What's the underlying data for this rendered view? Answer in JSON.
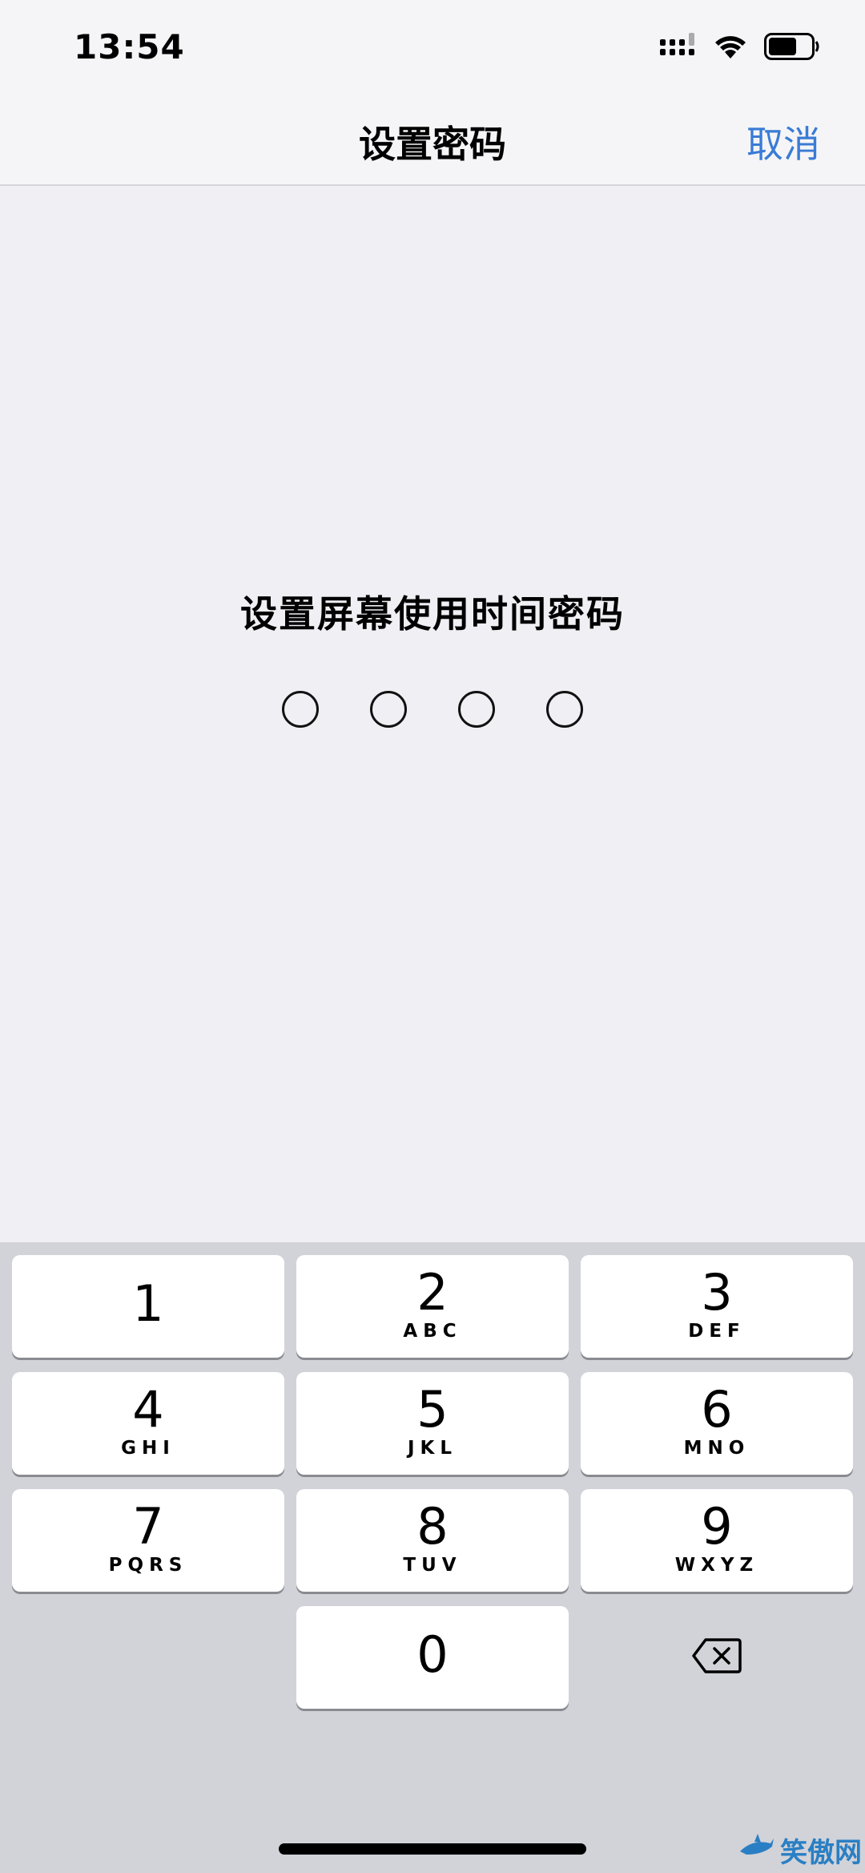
{
  "status_bar": {
    "time": "13:54",
    "icons": [
      "cellular-signal-icon",
      "wifi-icon",
      "battery-icon"
    ]
  },
  "nav": {
    "title": "设置密码",
    "cancel_label": "取消"
  },
  "passcode": {
    "prompt": "设置屏幕使用时间密码",
    "digit_count": 4,
    "entered": 0
  },
  "keypad": {
    "keys": [
      {
        "num": "1",
        "letters": ""
      },
      {
        "num": "2",
        "letters": "ABC"
      },
      {
        "num": "3",
        "letters": "DEF"
      },
      {
        "num": "4",
        "letters": "GHI"
      },
      {
        "num": "5",
        "letters": "JKL"
      },
      {
        "num": "6",
        "letters": "MNO"
      },
      {
        "num": "7",
        "letters": "PQRS"
      },
      {
        "num": "8",
        "letters": "TUV"
      },
      {
        "num": "9",
        "letters": "WXYZ"
      },
      {
        "num": "0",
        "letters": ""
      }
    ],
    "delete_icon": "delete-backspace-icon"
  },
  "watermark": {
    "text": "笑傲网"
  },
  "colors": {
    "accent": "#3a7bd5",
    "background": "#efeff4",
    "keypad_background": "#d2d3d8",
    "key_background": "#ffffff"
  }
}
